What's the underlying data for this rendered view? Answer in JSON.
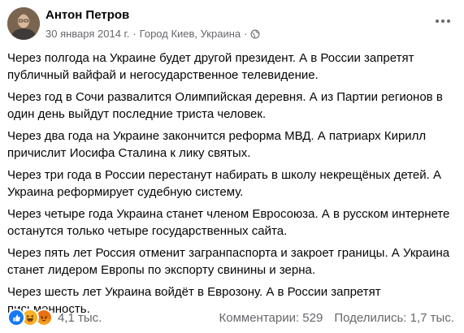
{
  "post": {
    "author": "Антон Петров",
    "date": "30 января 2014 г.",
    "separator": "·",
    "location": "Город Киев, Украина",
    "paragraphs": [
      "Через полгода на Украине будет другой президент. А в России запретят публичный вайфай и негосударственное телевидение.",
      "Через год в Сочи развалится Олимпийская деревня. А из Партии регионов в один день выйдут последние триста человек.",
      "Через два года на Украине закончится реформа МВД. А патриарх Кирилл причислит Иосифа Сталина к лику святых.",
      "Через три года в России перестанут набирать в школу некрещёных детей. А Украина реформирует судебную систему.",
      "Через четыре года Украина станет членом Евросоюза. А в русском интернете останутся только четыре государственных сайта.",
      "Через пять лет Россия отменит загранпаспорта и закроет границы. А Украина станет лидером Европы по экспорту свинины и зерна.",
      "Через шесть лет Украина войдёт в Еврозону. А в России запретят письменность."
    ]
  },
  "footer": {
    "reactions_count": "4,1 тыс.",
    "comments": "Комментарии: 529",
    "shares": "Поделились: 1,7 тыс."
  },
  "icons": {
    "reactions": [
      "like-icon",
      "haha-icon",
      "angry-icon"
    ],
    "privacy": "globe-icon",
    "menu": "more-dots-icon"
  },
  "colors": {
    "like": "#1877f2",
    "haha": "#f7b125",
    "angry": "#e9710f",
    "secondary_text": "#65676b"
  }
}
